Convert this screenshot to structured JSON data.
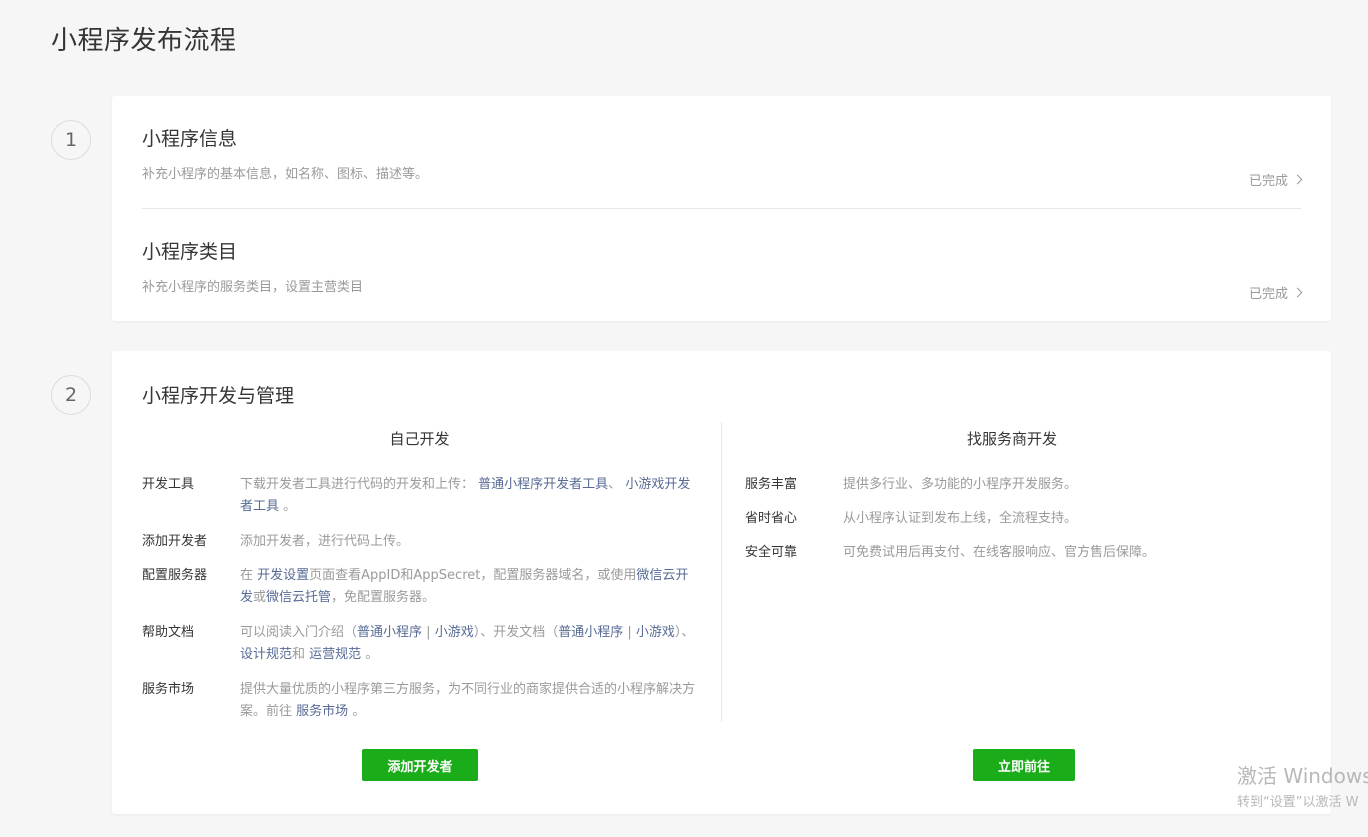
{
  "page_title": "小程序发布流程",
  "step1": {
    "number": "1",
    "rows": [
      {
        "title": "小程序信息",
        "desc": "补充小程序的基本信息，如名称、图标、描述等。",
        "status": "已完成"
      },
      {
        "title": "小程序类目",
        "desc": "补充小程序的服务类目，设置主营类目",
        "status": "已完成"
      }
    ]
  },
  "step2": {
    "number": "2",
    "title": "小程序开发与管理",
    "self": {
      "heading": "自己开发",
      "items": {
        "tools": {
          "label": "开发工具",
          "t1": "下载开发者工具进行代码的开发和上传：",
          "l1": "普通小程序开发者工具",
          "t2": "、",
          "l2": "小游戏开发者工具",
          "t3": " 。"
        },
        "add_dev": {
          "label": "添加开发者",
          "t1": "添加开发者，进行代码上传。"
        },
        "server": {
          "label": "配置服务器",
          "t1": "在 ",
          "l1": "开发设置",
          "t2": "页面查看AppID和AppSecret，配置服务器域名，或使用",
          "l2": "微信云开发",
          "t3": "或",
          "l3": "微信云托管",
          "t4": "，免配置服务器。"
        },
        "docs": {
          "label": "帮助文档",
          "t1": "可以阅读入门介绍（",
          "l1": "普通小程序",
          "t2": " | ",
          "l2": "小游戏",
          "t3": "）、开发文档（",
          "l3": "普通小程序",
          "t4": " | ",
          "l4": "小游戏",
          "t5": "）、",
          "l5": "设计规范",
          "t6": "和 ",
          "l6": "运营规范",
          "t7": " 。"
        },
        "market": {
          "label": "服务市场",
          "t1": "提供大量优质的小程序第三方服务，为不同行业的商家提供合适的小程序解决方案。前往 ",
          "l1": "服务市场",
          "t2": " 。"
        }
      },
      "button": "添加开发者"
    },
    "provider": {
      "heading": "找服务商开发",
      "items": [
        {
          "label": "服务丰富",
          "text": "提供多行业、多功能的小程序开发服务。"
        },
        {
          "label": "省时省心",
          "text": "从小程序认证到发布上线，全流程支持。"
        },
        {
          "label": "安全可靠",
          "text": "可免费试用后再支付、在线客服响应、官方售后保障。"
        }
      ],
      "button": "立即前往"
    }
  },
  "watermark": {
    "line1": "激活 Windows",
    "line2": "转到“设置”以激活 W"
  },
  "colors": {
    "accent_green": "#1aad19",
    "link_blue": "#576b95",
    "text_gray": "#9a9a9a",
    "background": "#f6f6f6"
  }
}
